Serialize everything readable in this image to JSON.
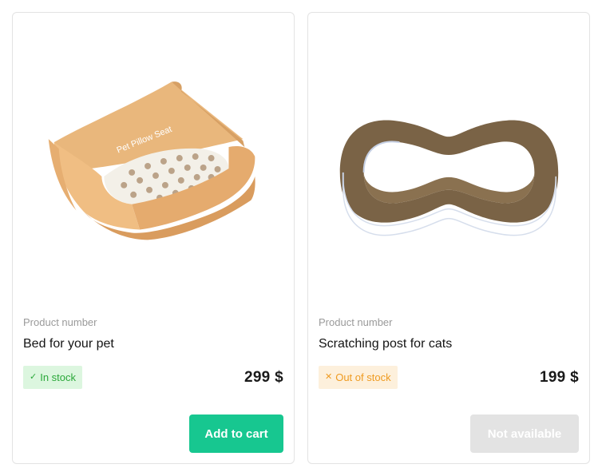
{
  "products": [
    {
      "image_alt": "pet-bed-image",
      "product_number_label": "Product number",
      "name": "Bed for your pet",
      "stock_status": "In stock",
      "stock_icon": "check-icon",
      "price": "299 $",
      "button_label": "Add to cart",
      "image_text": "Pet Pillow Seat"
    },
    {
      "image_alt": "scratching-post-image",
      "product_number_label": "Product number",
      "name": "Scratching post for cats",
      "stock_status": "Out of stock",
      "stock_icon": "x-icon",
      "price": "199 $",
      "button_label": "Not available"
    }
  ],
  "colors": {
    "accent": "#17c790",
    "in_stock_bg": "#dcf6df",
    "in_stock_text": "#2ba83a",
    "out_stock_bg": "#fdf0dc",
    "out_stock_text": "#ef9b21",
    "disabled": "#e3e3e3"
  }
}
